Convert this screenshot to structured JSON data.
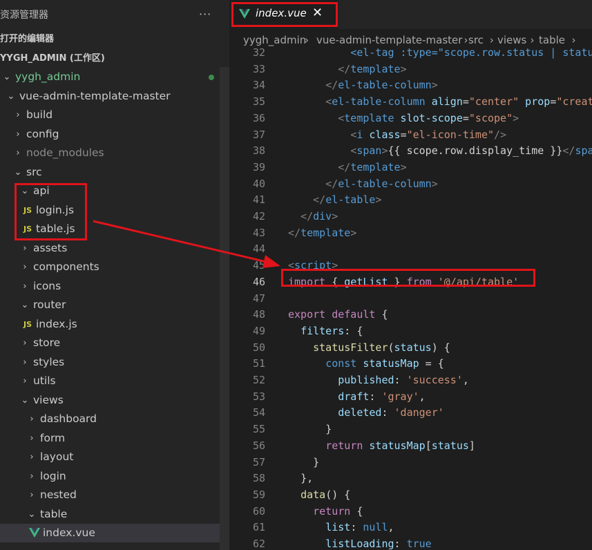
{
  "sidebar": {
    "title": "资源管理器",
    "more": "···",
    "open_editors": "打开的编辑器",
    "workspace": "YYGH_ADMIN (工作区)",
    "tree": [
      {
        "label": "yygh_admin",
        "chev": "⌄",
        "kind": "folder"
      },
      {
        "label": "vue-admin-template-master",
        "chev": "⌄",
        "kind": "folder"
      },
      {
        "label": "build",
        "chev": "›",
        "kind": "folder"
      },
      {
        "label": "config",
        "chev": "›",
        "kind": "folder"
      },
      {
        "label": "node_modules",
        "chev": "›",
        "kind": "folder"
      },
      {
        "label": "src",
        "chev": "⌄",
        "kind": "folder"
      },
      {
        "label": "api",
        "chev": "⌄",
        "kind": "folder"
      },
      {
        "label": "login.js",
        "icon": "JS",
        "kind": "js"
      },
      {
        "label": "table.js",
        "icon": "JS",
        "kind": "js"
      },
      {
        "label": "assets",
        "chev": "›",
        "kind": "folder"
      },
      {
        "label": "components",
        "chev": "›",
        "kind": "folder"
      },
      {
        "label": "icons",
        "chev": "›",
        "kind": "folder"
      },
      {
        "label": "router",
        "chev": "⌄",
        "kind": "folder"
      },
      {
        "label": "index.js",
        "icon": "JS",
        "kind": "js"
      },
      {
        "label": "store",
        "chev": "›",
        "kind": "folder"
      },
      {
        "label": "styles",
        "chev": "›",
        "kind": "folder"
      },
      {
        "label": "utils",
        "chev": "›",
        "kind": "folder"
      },
      {
        "label": "views",
        "chev": "⌄",
        "kind": "folder"
      },
      {
        "label": "dashboard",
        "chev": "›",
        "kind": "folder"
      },
      {
        "label": "form",
        "chev": "›",
        "kind": "folder"
      },
      {
        "label": "layout",
        "chev": "›",
        "kind": "folder"
      },
      {
        "label": "login",
        "chev": "›",
        "kind": "folder"
      },
      {
        "label": "nested",
        "chev": "›",
        "kind": "folder"
      },
      {
        "label": "table",
        "chev": "⌄",
        "kind": "folder"
      },
      {
        "label": "index.vue",
        "kind": "vue"
      }
    ]
  },
  "editor": {
    "tab": {
      "name": "index.vue",
      "close": "✕"
    },
    "breadcrumb": [
      "yygh_admin",
      "vue-admin-template-master",
      "src",
      "views",
      "table"
    ],
    "breadcrumb_sep": "›",
    "lines": [
      {
        "n": "32",
        "t": [
          [
            "          ",
            "plain"
          ],
          [
            "<el-tag :type=\"scope.row.status | statusFilter\">",
            "tag"
          ]
        ]
      },
      {
        "n": "33",
        "t": [
          [
            "        ",
            "plain"
          ],
          [
            "</",
            "punc"
          ],
          [
            "template",
            "tag"
          ],
          [
            ">",
            "punc"
          ]
        ]
      },
      {
        "n": "34",
        "t": [
          [
            "      ",
            "plain"
          ],
          [
            "</",
            "punc"
          ],
          [
            "el-table-column",
            "tag"
          ],
          [
            ">",
            "punc"
          ]
        ]
      },
      {
        "n": "35",
        "t": [
          [
            "      ",
            "plain"
          ],
          [
            "<",
            "punc"
          ],
          [
            "el-table-column",
            "tag"
          ],
          [
            " align",
            "attr"
          ],
          [
            "=",
            "plain"
          ],
          [
            "\"center\"",
            "str"
          ],
          [
            " prop",
            "attr"
          ],
          [
            "=",
            "plain"
          ],
          [
            "\"created_at\"",
            "str"
          ]
        ]
      },
      {
        "n": "36",
        "t": [
          [
            "        ",
            "plain"
          ],
          [
            "<",
            "punc"
          ],
          [
            "template",
            "tag"
          ],
          [
            " slot-scope",
            "attr"
          ],
          [
            "=",
            "plain"
          ],
          [
            "\"scope\"",
            "str"
          ],
          [
            ">",
            "punc"
          ]
        ]
      },
      {
        "n": "37",
        "t": [
          [
            "          ",
            "plain"
          ],
          [
            "<",
            "punc"
          ],
          [
            "i",
            "tag"
          ],
          [
            " class",
            "attr"
          ],
          [
            "=",
            "plain"
          ],
          [
            "\"el-icon-time\"",
            "str"
          ],
          [
            "/>",
            "punc"
          ]
        ]
      },
      {
        "n": "38",
        "t": [
          [
            "          ",
            "plain"
          ],
          [
            "<",
            "punc"
          ],
          [
            "span",
            "tag"
          ],
          [
            ">",
            "punc"
          ],
          [
            "{{ scope.row.display_time }}",
            "plain"
          ],
          [
            "</",
            "punc"
          ],
          [
            "span",
            "tag"
          ],
          [
            ">",
            "punc"
          ]
        ]
      },
      {
        "n": "39",
        "t": [
          [
            "        ",
            "plain"
          ],
          [
            "</",
            "punc"
          ],
          [
            "template",
            "tag"
          ],
          [
            ">",
            "punc"
          ]
        ]
      },
      {
        "n": "40",
        "t": [
          [
            "      ",
            "plain"
          ],
          [
            "</",
            "punc"
          ],
          [
            "el-table-column",
            "tag"
          ],
          [
            ">",
            "punc"
          ]
        ]
      },
      {
        "n": "41",
        "t": [
          [
            "    ",
            "plain"
          ],
          [
            "</",
            "punc"
          ],
          [
            "el-table",
            "tag"
          ],
          [
            ">",
            "punc"
          ]
        ]
      },
      {
        "n": "42",
        "t": [
          [
            "  ",
            "plain"
          ],
          [
            "</",
            "punc"
          ],
          [
            "div",
            "tag"
          ],
          [
            ">",
            "punc"
          ]
        ]
      },
      {
        "n": "43",
        "t": [
          [
            "</",
            "punc"
          ],
          [
            "template",
            "tag"
          ],
          [
            ">",
            "punc"
          ]
        ]
      },
      {
        "n": "44",
        "t": []
      },
      {
        "n": "45",
        "t": [
          [
            "<",
            "punc"
          ],
          [
            "script",
            "tag"
          ],
          [
            ">",
            "punc"
          ]
        ]
      },
      {
        "n": "46",
        "t": [
          [
            "import",
            "kw"
          ],
          [
            " { ",
            "plain"
          ],
          [
            "getList",
            "var"
          ],
          [
            " } ",
            "plain"
          ],
          [
            "from",
            "kw"
          ],
          [
            " ",
            "plain"
          ],
          [
            "'@/api/table'",
            "str"
          ]
        ],
        "current": true
      },
      {
        "n": "47",
        "t": []
      },
      {
        "n": "48",
        "t": [
          [
            "export",
            "kw"
          ],
          [
            " ",
            "plain"
          ],
          [
            "default",
            "kw"
          ],
          [
            " {",
            "plain"
          ]
        ]
      },
      {
        "n": "49",
        "t": [
          [
            "  ",
            "plain"
          ],
          [
            "filters",
            "var"
          ],
          [
            ": {",
            "plain"
          ]
        ]
      },
      {
        "n": "50",
        "t": [
          [
            "    ",
            "plain"
          ],
          [
            "statusFilter",
            "fn"
          ],
          [
            "(",
            "plain"
          ],
          [
            "status",
            "var"
          ],
          [
            ") {",
            "plain"
          ]
        ]
      },
      {
        "n": "51",
        "t": [
          [
            "      ",
            "plain"
          ],
          [
            "const",
            "kw2"
          ],
          [
            " ",
            "plain"
          ],
          [
            "statusMap",
            "var"
          ],
          [
            " = {",
            "plain"
          ]
        ]
      },
      {
        "n": "52",
        "t": [
          [
            "        ",
            "plain"
          ],
          [
            "published",
            "var"
          ],
          [
            ": ",
            "plain"
          ],
          [
            "'success'",
            "str"
          ],
          [
            ",",
            "plain"
          ]
        ]
      },
      {
        "n": "53",
        "t": [
          [
            "        ",
            "plain"
          ],
          [
            "draft",
            "var"
          ],
          [
            ": ",
            "plain"
          ],
          [
            "'gray'",
            "str"
          ],
          [
            ",",
            "plain"
          ]
        ]
      },
      {
        "n": "54",
        "t": [
          [
            "        ",
            "plain"
          ],
          [
            "deleted",
            "var"
          ],
          [
            ": ",
            "plain"
          ],
          [
            "'danger'",
            "str"
          ]
        ]
      },
      {
        "n": "55",
        "t": [
          [
            "      ",
            "plain"
          ],
          [
            "}",
            "plain"
          ]
        ]
      },
      {
        "n": "56",
        "t": [
          [
            "      ",
            "plain"
          ],
          [
            "return",
            "kw"
          ],
          [
            " ",
            "plain"
          ],
          [
            "statusMap",
            "var"
          ],
          [
            "[",
            "plain"
          ],
          [
            "status",
            "var"
          ],
          [
            "]",
            "plain"
          ]
        ]
      },
      {
        "n": "57",
        "t": [
          [
            "    ",
            "plain"
          ],
          [
            "}",
            "plain"
          ]
        ]
      },
      {
        "n": "58",
        "t": [
          [
            "  ",
            "plain"
          ],
          [
            "},",
            "plain"
          ]
        ]
      },
      {
        "n": "59",
        "t": [
          [
            "  ",
            "plain"
          ],
          [
            "data",
            "fn"
          ],
          [
            "() {",
            "plain"
          ]
        ]
      },
      {
        "n": "60",
        "t": [
          [
            "    ",
            "plain"
          ],
          [
            "return",
            "kw"
          ],
          [
            " {",
            "plain"
          ]
        ]
      },
      {
        "n": "61",
        "t": [
          [
            "      ",
            "plain"
          ],
          [
            "list",
            "var"
          ],
          [
            ": ",
            "plain"
          ],
          [
            "null",
            "kw2"
          ],
          [
            ",",
            "plain"
          ]
        ]
      },
      {
        "n": "62",
        "t": [
          [
            "      ",
            "plain"
          ],
          [
            "listLoading",
            "var"
          ],
          [
            ": ",
            "plain"
          ],
          [
            "true",
            "kw2"
          ]
        ]
      }
    ]
  },
  "colors": {
    "highlight": "#e0141a",
    "vue_green": "#41b883",
    "js_yellow": "#cbcb41"
  }
}
